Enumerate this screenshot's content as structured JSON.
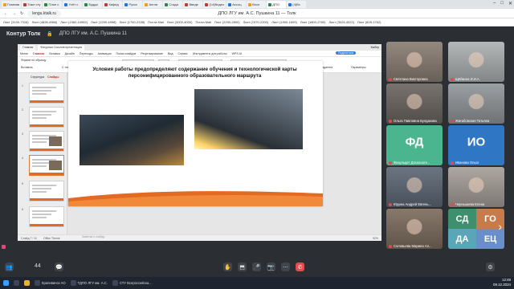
{
  "browser": {
    "tabs": [
      {
        "label": "Главная"
      },
      {
        "label": "Тоже сту"
      },
      {
        "label": "План с"
      },
      {
        "label": "Учёт с"
      },
      {
        "label": "Будда"
      },
      {
        "label": "Кафед"
      },
      {
        "label": "Русск"
      },
      {
        "label": "Англи"
      },
      {
        "label": "Созда"
      },
      {
        "label": "Введе"
      },
      {
        "label": "(14)Видео"
      },
      {
        "label": "Ассоц"
      },
      {
        "label": "Восп"
      },
      {
        "label": "ДПО"
      },
      {
        "label": "(4)Вх"
      }
    ],
    "url": "lengu.ktalk.ru",
    "page_title": "ДПО ЛГУ им. А.С. Пушкина 11 — Толк",
    "bookmarks": [
      "Лист (3100-7316)",
      "Лист (4828-4986)",
      "Лист (1982-10982)",
      "Лист (1290-4998)",
      "Лист (1760-2338)",
      "Почта Mail",
      "Лист (3000-4000)",
      "Почта Mail",
      "Лист (2290-2800)",
      "Лист (1570-2200)",
      "Лист (1900-1609)",
      "Лист (1800-2760)",
      "Лист (3024-4022)",
      "Лист (828-1762)"
    ]
  },
  "meeting": {
    "brand": "Контур Толк",
    "room": "ДПО ЛГУ им. А.С. Пушкина 11",
    "participants_count": "44",
    "participants": [
      {
        "name": "Святлана Викторовна",
        "type": "camera",
        "bg": "#8b7f74"
      },
      {
        "name": "Щёйкина И.И.А.",
        "type": "camera",
        "bg": "#aeb2b3"
      },
      {
        "name": "Ольга Павловна Булдакова",
        "type": "camera",
        "bg": "#6d6762"
      },
      {
        "name": "Жигабовская Татьяна",
        "type": "camera",
        "bg": "#93989c"
      },
      {
        "name": "Фазульдет Досконате...",
        "type": "initials",
        "initials": "ФД",
        "bg": "#4bb58f"
      },
      {
        "name": "Иванова Ольга",
        "type": "initials",
        "initials": "ИО",
        "bg": "#2f76c4"
      },
      {
        "name": "Юдина Андрей Евгень...",
        "type": "camera",
        "bg": "#5f6a77"
      },
      {
        "name": "Чернышева Елена",
        "type": "camera",
        "bg": "#a7a09a"
      },
      {
        "name": "Соловьева Марина Ал...",
        "type": "camera",
        "bg": "#7e6e5f"
      },
      {
        "name": "",
        "type": "multi",
        "initials": [
          "СД",
          "ГО",
          "ДА",
          "ЕЦ"
        ],
        "bg": "#3d8f6e"
      }
    ]
  },
  "presentation": {
    "tabs": [
      "Главная",
      "Фигурная Соколов презентация"
    ],
    "app_title": "Кыбер",
    "share_label": "Поделиться",
    "ribbon_menu": [
      "Меню",
      "Главная",
      "Вставка",
      "Дизайн",
      "Переходы",
      "Анимация",
      "Показ слайдов",
      "Рецензирование",
      "Вид",
      "Сервис",
      "Инструменты для работы",
      "WPS AI"
    ],
    "ribbon_active": "Главная",
    "ribbon_left": [
      "Формат по образцу",
      "Вставить",
      "С текущего слайда",
      "Макет"
    ],
    "ribbon_right": [
      "Инструменты для создателя",
      "Параметры"
    ],
    "thumb_tabs": [
      "Структура",
      "Слайды"
    ],
    "thumb_numbers": [
      "1",
      "2",
      "3",
      "4",
      "5",
      "6"
    ],
    "slide_title": "Условия работы предопределяют содержание обучения и технологической карты персонифицированного образовательного маршрута",
    "status_slide": "Слайд 7 / 11",
    "status_theme": "Office Theme",
    "notes_placeholder": "Заметки к слайду",
    "zoom": "92%"
  },
  "taskbar": {
    "items": [
      "Крапивинск АО",
      "ТДПО ЛГУ им. А.С.",
      "СТУ Всероссийска..."
    ],
    "time": "12:49",
    "date": "09.12.2024"
  },
  "colors": {
    "accent": "#e36a22",
    "meeting_bg": "#2b2e33",
    "leave_red": "#e5484d"
  }
}
